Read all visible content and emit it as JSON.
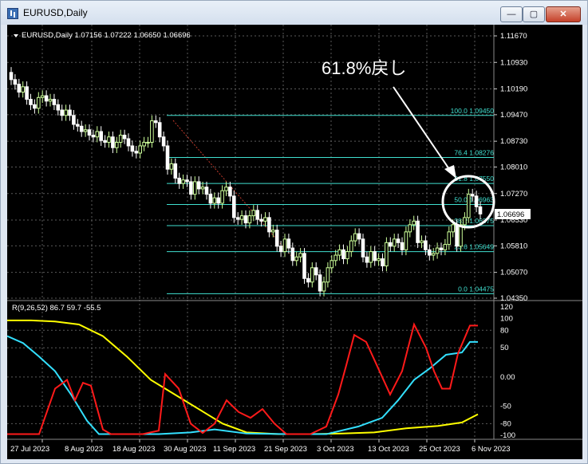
{
  "window": {
    "title": "EURUSD,Daily",
    "minimize_glyph": "—",
    "maximize_glyph": "▢",
    "close_glyph": "✕"
  },
  "chart_header": {
    "label": "EURUSD,Daily  1.07156 1.07222 1.06650 1.06696"
  },
  "annotation": {
    "text": "61.8%戻し"
  },
  "colors": {
    "background": "#000000",
    "bull_candle": "#ccff99",
    "bear_candle": "#ffffff",
    "fib": "#40e0d0",
    "grid": "#6e6e6e",
    "rsi_red": "#ff1a1a",
    "rsi_cyan": "#33e0ff",
    "rsi_yellow": "#ffff00",
    "current_price_box": "#ffffff"
  },
  "price_axis": {
    "ticks": [
      "1.11670",
      "1.10930",
      "1.10190",
      "1.09470",
      "1.08730",
      "1.08010",
      "1.07270",
      "1.06530",
      "1.05810",
      "1.05070",
      "1.04350"
    ],
    "current_price": "1.06696"
  },
  "fib_levels": [
    {
      "label": "100.0  1.09450",
      "price": 1.0945
    },
    {
      "label": "76.4  1.08276",
      "price": 1.08276
    },
    {
      "label": "61.8  1.07550",
      "price": 1.0755
    },
    {
      "label": "50.0  1.06963",
      "price": 1.06963
    },
    {
      "label": "38.2  1.06375",
      "price": 1.06375
    },
    {
      "label": "23.6  1.05649",
      "price": 1.05649
    },
    {
      "label": "0.0  1.04475",
      "price": 1.04475
    }
  ],
  "indicator": {
    "label": "R(9,26,52) 86.7 59.7 -55.5",
    "ticks": [
      "120",
      "100",
      "80",
      "50",
      "0.00",
      "-50",
      "-80",
      "-100"
    ]
  },
  "time_axis": {
    "labels": [
      "27 Jul 2023",
      "8 Aug 2023",
      "18 Aug 2023",
      "30 Aug 2023",
      "11 Sep 2023",
      "21 Sep 2023",
      "3 Oct 2023",
      "13 Oct 2023",
      "25 Oct 2023",
      "6 Nov 2023"
    ]
  }
}
